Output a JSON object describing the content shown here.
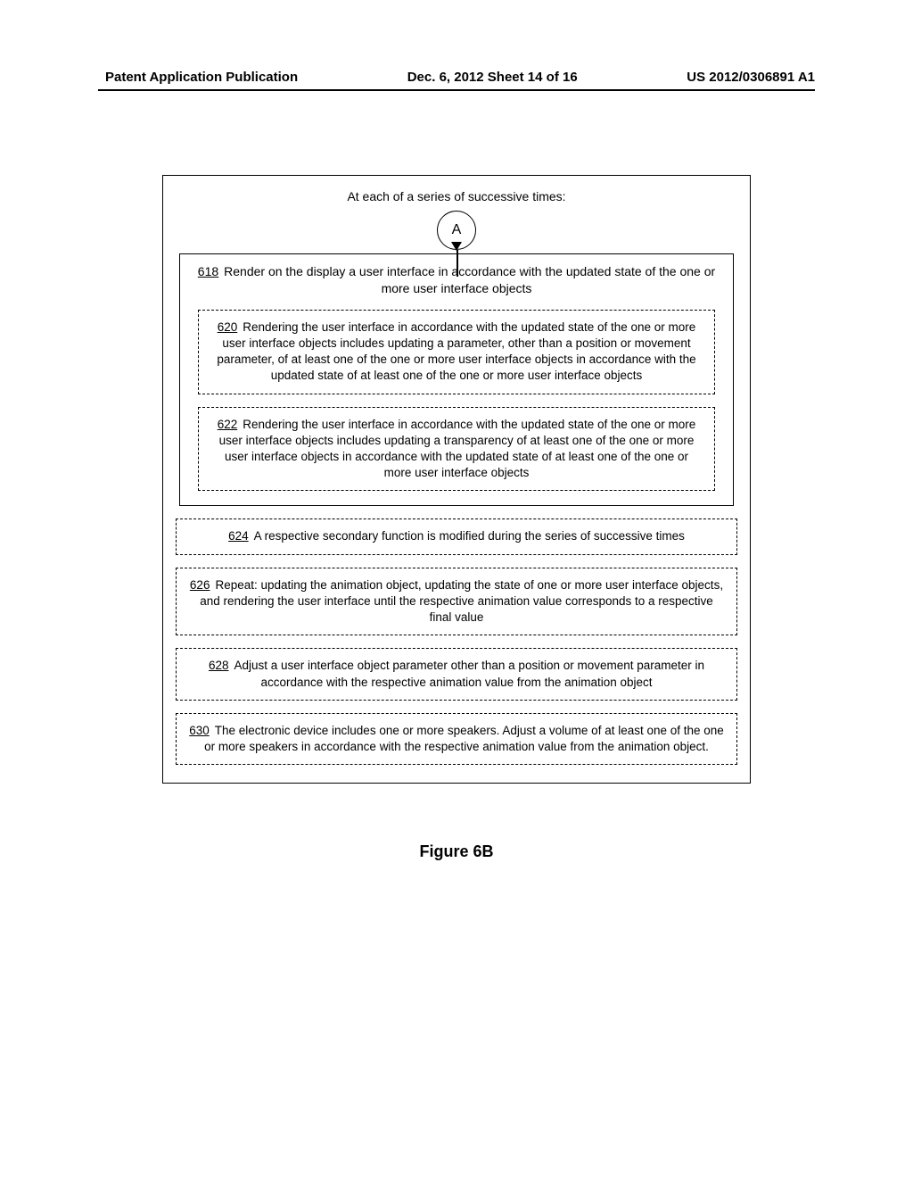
{
  "header": {
    "left": "Patent Application Publication",
    "center": "Dec. 6, 2012   Sheet 14 of 16",
    "right": "US 2012/0306891 A1"
  },
  "outer_title": "At each of a series of successive times:",
  "connector": "A",
  "box618": {
    "num": "618",
    "text": "Render on the display a user interface in accordance with the updated state of the one or more user interface objects"
  },
  "box620": {
    "num": "620",
    "text": "Rendering the user interface in accordance with the updated state of the one or more user interface objects includes updating a parameter, other than a position or movement parameter, of at least one of the one or more user interface objects in accordance with the updated state of at least one of the one or more user interface objects"
  },
  "box622": {
    "num": "622",
    "text": "Rendering the user interface in accordance with the updated state of the one or more user interface objects includes updating a transparency of at least one of the one or more user interface objects in accordance with the updated state of at least one of the one or more user interface objects"
  },
  "box624": {
    "num": "624",
    "text": "A respective secondary function is modified during the series of successive times"
  },
  "box626": {
    "num": "626",
    "text": "Repeat: updating the animation object, updating the state of one or more user interface objects, and rendering the user interface until the respective animation value corresponds to a respective final value"
  },
  "box628": {
    "num": "628",
    "text": "Adjust a user interface object parameter other than a position or movement parameter in accordance with the respective animation value from the animation object"
  },
  "box630": {
    "num": "630",
    "text": "The electronic device includes one or more speakers.  Adjust a volume of at least one of the one or more speakers in accordance with the respective animation value from the animation object."
  },
  "figure_label": "Figure 6B"
}
